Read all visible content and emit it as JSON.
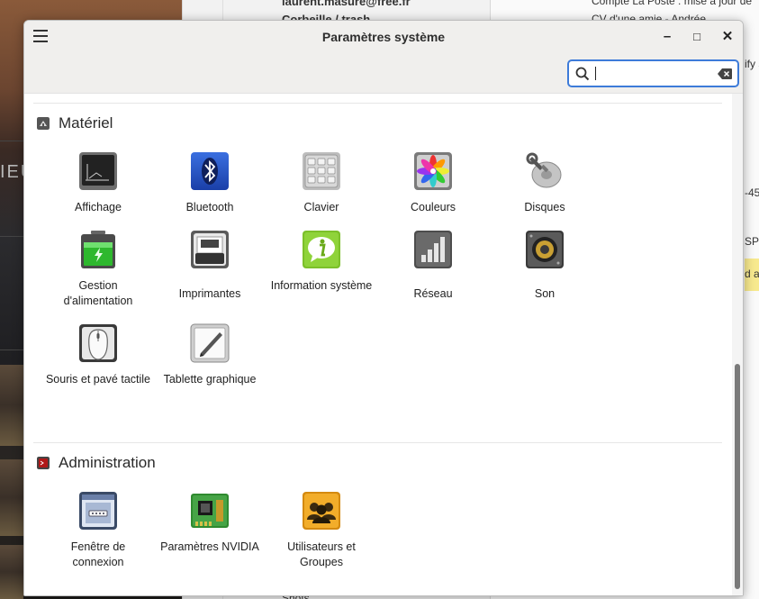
{
  "background": {
    "left_text": "IEU",
    "mail_sender": "laurent.masure@free.fr",
    "mail_folder": "Corbeille / trash",
    "folder_bottom": "Shots",
    "subject_1": "Compte La Poste : mise à jour de",
    "subject_2": "CV d'une amie - Andrée",
    "fragments": [
      "ify s",
      "-45",
      "SP",
      "d a"
    ]
  },
  "window": {
    "title": "Paramètres système",
    "minimize": "–",
    "maximize": "□",
    "close": "✕"
  },
  "search": {
    "value": "",
    "placeholder": ""
  },
  "sections": [
    {
      "title": "Matériel",
      "items": [
        {
          "label": "Affichage",
          "icon": "display-icon"
        },
        {
          "label": "Bluetooth",
          "icon": "bluetooth-icon"
        },
        {
          "label": "Clavier",
          "icon": "keyboard-icon"
        },
        {
          "label": "Couleurs",
          "icon": "colors-icon"
        },
        {
          "label": "Disques",
          "icon": "disks-icon"
        },
        {
          "label": "Gestion d'alimentation",
          "icon": "battery-icon"
        },
        {
          "label": "Imprimantes",
          "icon": "printer-icon"
        },
        {
          "label": "Information système",
          "icon": "info-icon"
        },
        {
          "label": "Réseau",
          "icon": "network-icon"
        },
        {
          "label": "Son",
          "icon": "speaker-icon"
        },
        {
          "label": "Souris et pavé tactile",
          "icon": "mouse-icon"
        },
        {
          "label": "Tablette graphique",
          "icon": "tablet-icon"
        }
      ]
    },
    {
      "title": "Administration",
      "items": [
        {
          "label": "Fenêtre de connexion",
          "icon": "login-window-icon"
        },
        {
          "label": "Paramètres NVIDIA",
          "icon": "nvidia-chip-icon"
        },
        {
          "label": "Utilisateurs et Groupes",
          "icon": "users-groups-icon"
        }
      ]
    }
  ],
  "colors": {
    "accent": "#3d7bd9",
    "titlebar": "#f0efed"
  }
}
